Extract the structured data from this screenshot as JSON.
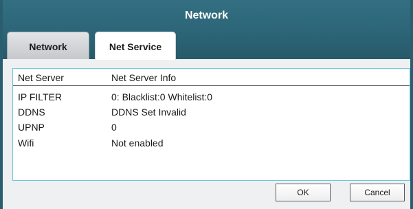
{
  "window": {
    "title": "Network"
  },
  "tabs": [
    {
      "label": "Network",
      "active": false
    },
    {
      "label": "Net Service",
      "active": true
    }
  ],
  "table": {
    "columns": [
      "Net Server",
      "Net Server Info"
    ],
    "rows": [
      {
        "name": "IP FILTER",
        "info": "0: Blacklist:0 Whitelist:0"
      },
      {
        "name": "DDNS",
        "info": "DDNS Set Invalid"
      },
      {
        "name": "UPNP",
        "info": "0"
      },
      {
        "name": "Wifi",
        "info": "Not enabled"
      }
    ]
  },
  "buttons": {
    "ok_label": "OK",
    "cancel_label": "Cancel"
  },
  "colors": {
    "titlebar": "#2b6476",
    "panel_border": "#6fc4dc",
    "background": "#eef0f2"
  }
}
